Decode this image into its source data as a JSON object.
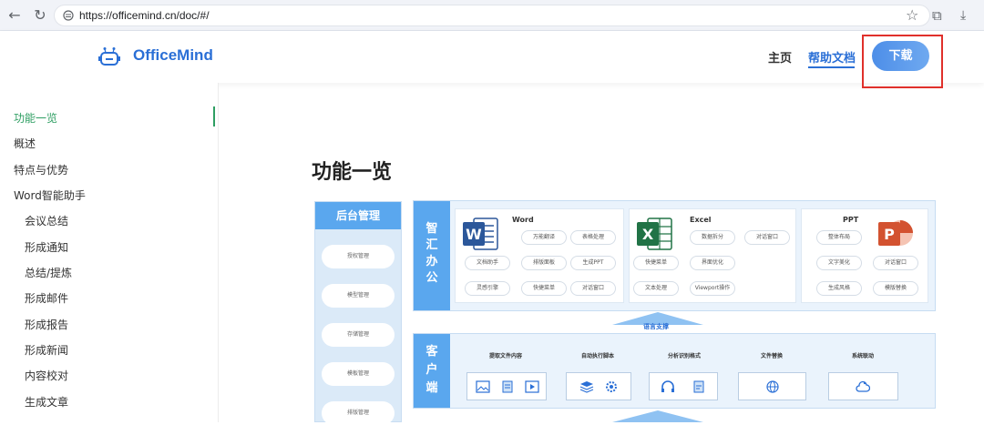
{
  "browser": {
    "url": "https://officemind.cn/doc/#/",
    "back_label": "←",
    "reload_label": "↻",
    "star_label": "☆",
    "extensions_label": "⧉",
    "download_label": "⤓"
  },
  "header": {
    "brand": "OfficeMind",
    "nav": {
      "home": "主页",
      "docs": "帮助文档"
    },
    "download_button": "下载"
  },
  "sidebar": {
    "items": [
      {
        "label": "功能一览",
        "active": true,
        "level": 0
      },
      {
        "label": "概述",
        "level": 0
      },
      {
        "label": "特点与优势",
        "level": 0
      },
      {
        "label": "Word智能助手",
        "level": 0
      },
      {
        "label": "会议总结",
        "level": 1
      },
      {
        "label": "形成通知",
        "level": 1
      },
      {
        "label": "总结/提炼",
        "level": 1
      },
      {
        "label": "形成邮件",
        "level": 1
      },
      {
        "label": "形成报告",
        "level": 1
      },
      {
        "label": "形成新闻",
        "level": 1
      },
      {
        "label": "内容校对",
        "level": 1
      },
      {
        "label": "生成文章",
        "level": 1
      }
    ]
  },
  "main": {
    "title": "功能一览",
    "backend": {
      "title": "后台管理",
      "items": [
        "授权管理",
        "模型管理",
        "存储管理",
        "模板管理",
        "排版管理"
      ]
    },
    "office": {
      "label_chars": [
        "智",
        "汇",
        "办",
        "公"
      ],
      "word": {
        "title": "Word",
        "chips": [
          "万能翻译",
          "表格处理",
          "文档助手",
          "排版面板",
          "生成PPT",
          "灵感引擎",
          "快捷菜单",
          "对话窗口"
        ]
      },
      "excel": {
        "title": "Excel",
        "chips": [
          "数据拆分",
          "对话窗口",
          "快捷菜单",
          "界面优化",
          "文本处理",
          "Viewport操作"
        ]
      },
      "ppt": {
        "title": "PPT",
        "chips": [
          "整体布局",
          "文字美化",
          "对话窗口",
          "生成风格",
          "模版替换"
        ]
      }
    },
    "support_label": "语言支撑",
    "client": {
      "label_chars": [
        "客",
        "户",
        "端"
      ],
      "columns": [
        "提取文件内容",
        "自动执行脚本",
        "分析识别格式",
        "文件替换",
        "系统联动"
      ]
    }
  },
  "colors": {
    "brand_blue": "#2a6fd6",
    "active_green": "#2e9e62",
    "panel_blue": "#5aa7ee",
    "highlight_red": "#e0302b"
  }
}
